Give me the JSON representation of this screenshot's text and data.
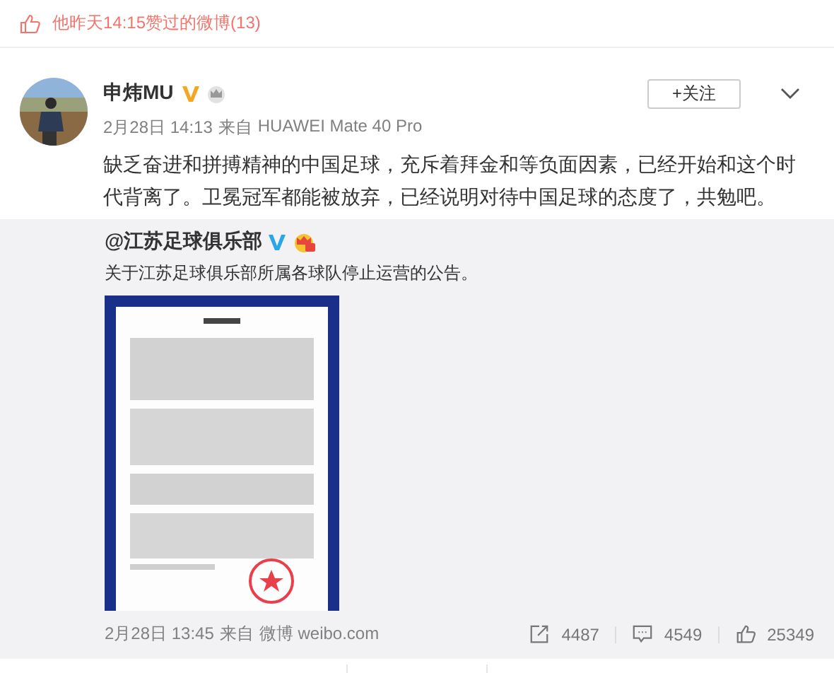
{
  "like_notice": {
    "text": "他昨天14:15赞过的微博(13)"
  },
  "post": {
    "author": "申炜MU",
    "verified": true,
    "vip": true,
    "follow_button": "+关注",
    "time": "2月28日 14:13",
    "source_prefix": "来自",
    "source": "HUAWEI Mate 40 Pro",
    "text": "缺乏奋进和拼搏精神的中国足球，充斥着拜金和等负面因素，已经开始和这个时代背离了。卫冕冠军都能被放弃，已经说明对待中国足球的态度了，共勉吧。",
    "repost": {
      "author": "@江苏足球俱乐部",
      "verified": true,
      "vip": true,
      "text": "关于江苏足球俱乐部所属各球队停止运营的公告。",
      "time": "2月28日 13:45",
      "source_prefix": "来自",
      "source": "微博 weibo.com",
      "actions": [
        {
          "kind": "repost",
          "count": "4487"
        },
        {
          "kind": "comment",
          "count": "4549"
        },
        {
          "kind": "like",
          "count": "25349"
        }
      ]
    }
  }
}
